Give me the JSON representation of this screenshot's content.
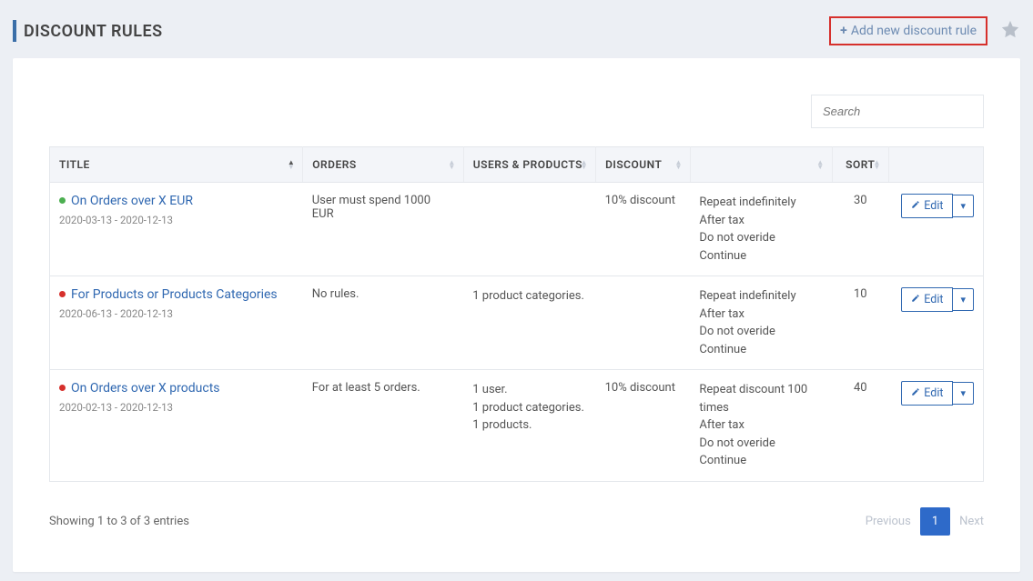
{
  "header": {
    "title": "DISCOUNT RULES",
    "add_button": "Add new discount rule"
  },
  "search": {
    "placeholder": "Search"
  },
  "columns": {
    "title": "TITLE",
    "orders": "ORDERS",
    "users_products": "USERS & PRODUCTS",
    "discount": "DISCOUNT",
    "empty": "",
    "sort": "SORT",
    "actions": ""
  },
  "rows": [
    {
      "status_color": "green",
      "title": "On Orders over X EUR",
      "dates": "2020-03-13 - 2020-12-13",
      "orders": "User must spend 1000 EUR",
      "users_products": "",
      "discount": "10% discount",
      "rules": [
        "Repeat indefinitely",
        "After tax",
        "Do not overide",
        "Continue"
      ],
      "sort": "30"
    },
    {
      "status_color": "red",
      "title": "For Products or Products Categories",
      "dates": "2020-06-13 - 2020-12-13",
      "orders": "No rules.",
      "users_products": "1 product categories.",
      "discount": "",
      "rules": [
        "Repeat indefinitely",
        "After tax",
        "Do not overide",
        "Continue"
      ],
      "sort": "10"
    },
    {
      "status_color": "red",
      "title": "On Orders over X products",
      "dates": "2020-02-13 - 2020-12-13",
      "orders": "For at least 5 orders.",
      "users_products": "1 user.\n1 product categories.\n1 products.",
      "discount": "10% discount",
      "rules": [
        "Repeat discount 100 times",
        "After tax",
        "Do not overide",
        "Continue"
      ],
      "sort": "40"
    }
  ],
  "edit_label": "Edit",
  "footer": {
    "info": "Showing 1 to 3 of 3 entries",
    "prev": "Previous",
    "page": "1",
    "next": "Next"
  }
}
